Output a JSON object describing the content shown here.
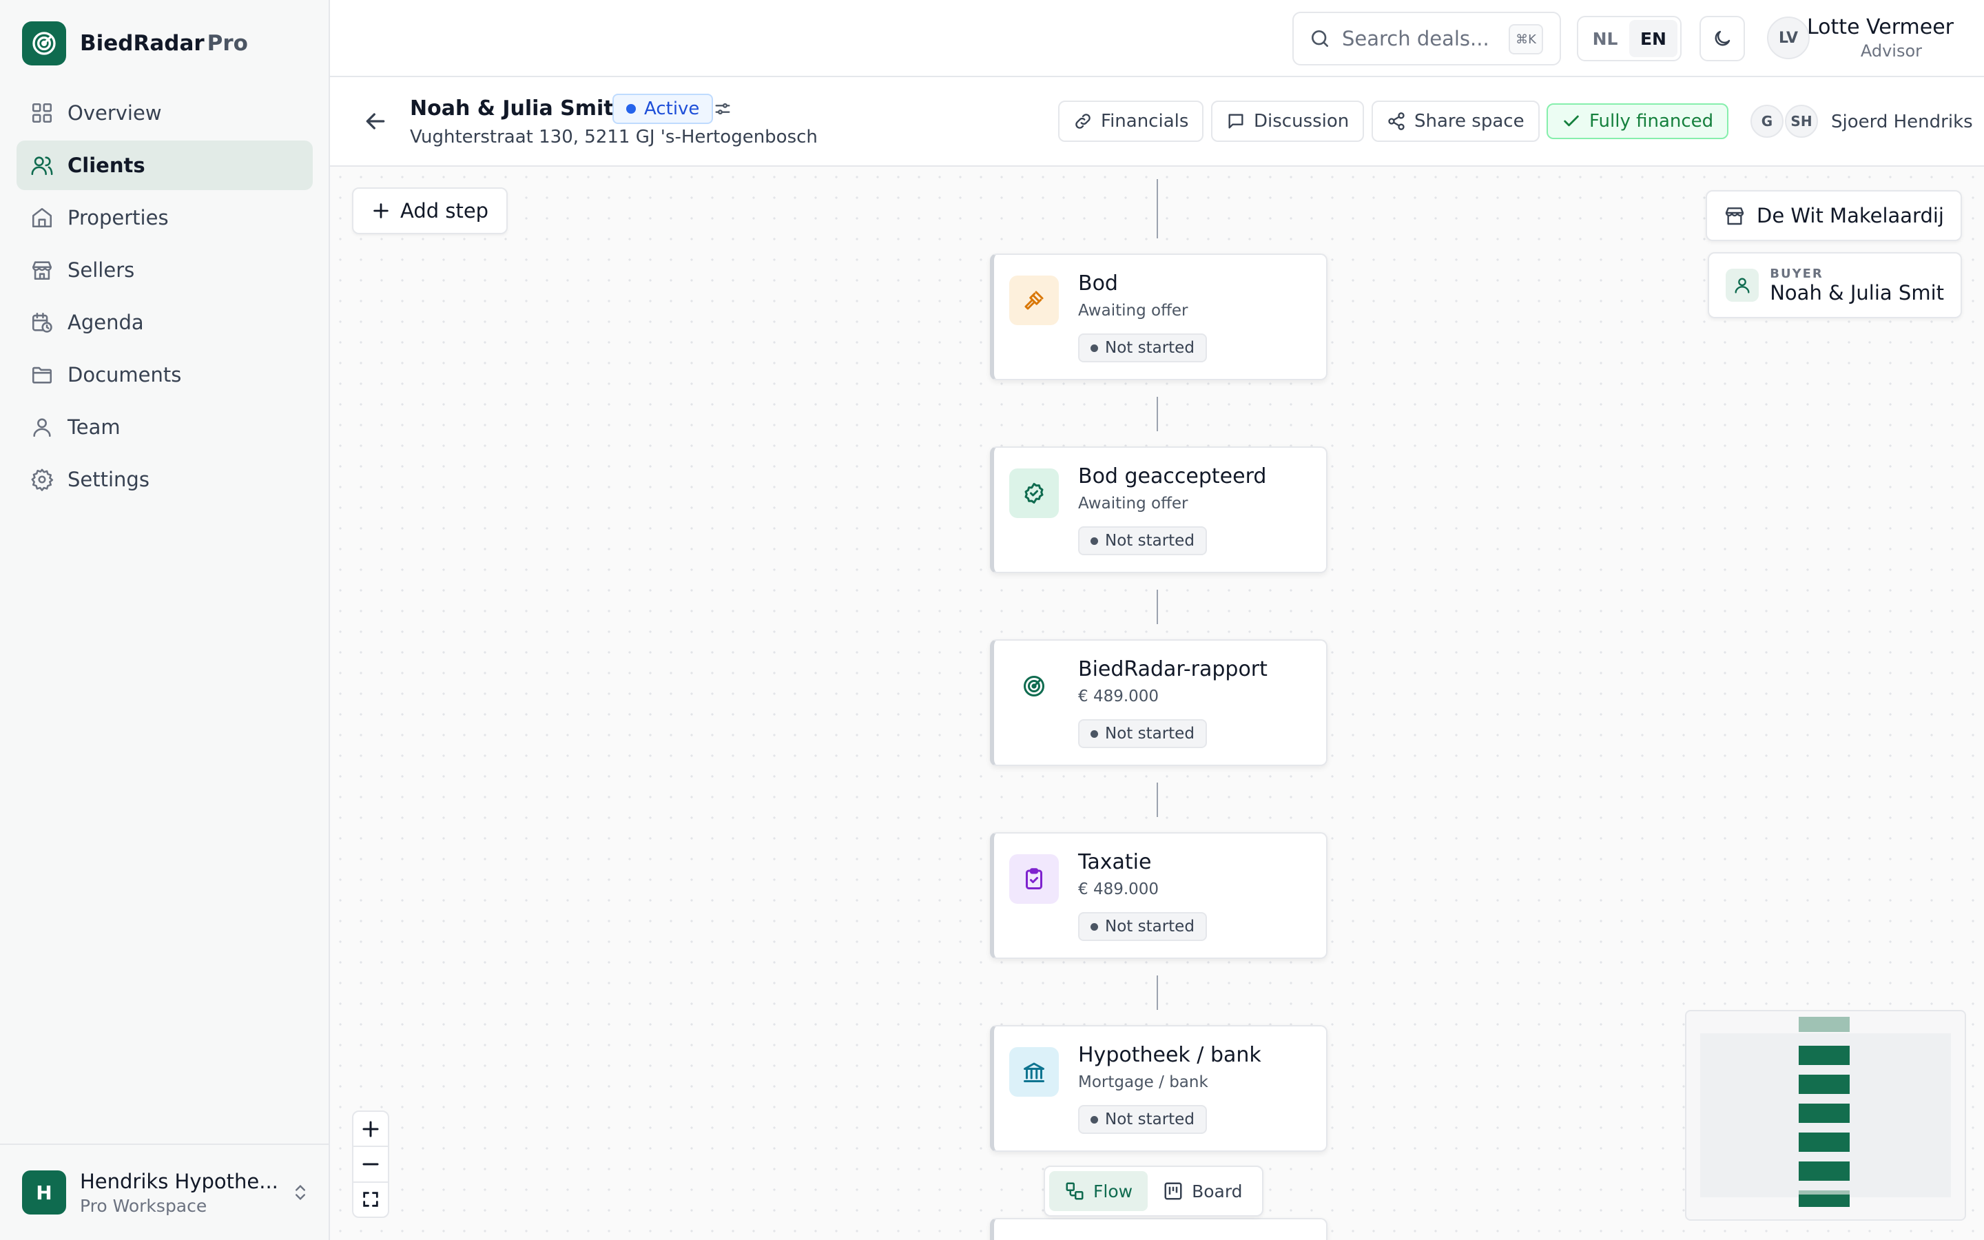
{
  "app": {
    "brand_name": "BiedRadar",
    "brand_suffix": "Pro",
    "accent_color": "#0f6b4f"
  },
  "sidebar": {
    "items": [
      {
        "label": "Overview",
        "icon": "grid-icon"
      },
      {
        "label": "Clients",
        "icon": "users-icon",
        "active": true
      },
      {
        "label": "Properties",
        "icon": "home-icon"
      },
      {
        "label": "Sellers",
        "icon": "store-icon"
      },
      {
        "label": "Agenda",
        "icon": "calendar-clock-icon"
      },
      {
        "label": "Documents",
        "icon": "folder-icon"
      },
      {
        "label": "Team",
        "icon": "user-icon"
      },
      {
        "label": "Settings",
        "icon": "gear-icon"
      }
    ],
    "workspace": {
      "initial": "H",
      "name": "Hendriks Hypothe...",
      "plan": "Pro Workspace"
    }
  },
  "topbar": {
    "search_placeholder": "Search deals...",
    "search_shortcut": "⌘K",
    "languages": [
      "NL",
      "EN"
    ],
    "active_language": "EN",
    "user": {
      "initials": "LV",
      "name": "Lotte Vermeer",
      "role": "Advisor"
    }
  },
  "deal": {
    "title": "Noah & Julia Smit",
    "status": "Active",
    "address": "Vughterstraat 130, 5211 GJ 's-Hertogenbosch",
    "actions": {
      "financials": "Financials",
      "discussion": "Discussion",
      "share": "Share space",
      "financed": "Fully financed"
    },
    "avatars": [
      "G",
      "SH"
    ],
    "assignee": "Sjoerd Hendriks"
  },
  "canvas": {
    "add_step": "Add step",
    "steps": [
      {
        "title": "Bod",
        "subtitle": "Awaiting offer",
        "status": "Not started",
        "icon": "gavel-icon"
      },
      {
        "title": "Bod geaccepteerd",
        "subtitle": "Awaiting offer",
        "status": "Not started",
        "icon": "check-circle-icon"
      },
      {
        "title": "BiedRadar-rapport",
        "subtitle": "€ 489.000",
        "status": "Not started",
        "icon": "radar-icon"
      },
      {
        "title": "Taxatie",
        "subtitle": "€ 489.000",
        "status": "Not started",
        "icon": "clipboard-check-icon"
      },
      {
        "title": "Hypotheek / bank",
        "subtitle": "Mortgage / bank",
        "status": "Not started",
        "icon": "bank-icon"
      }
    ],
    "parties": {
      "agency": "De Wit Makelaardij",
      "buyer_label": "BUYER",
      "buyer_name": "Noah & Julia Smit"
    },
    "view_toggle": {
      "flow": "Flow",
      "board": "Board",
      "active": "Flow"
    }
  }
}
